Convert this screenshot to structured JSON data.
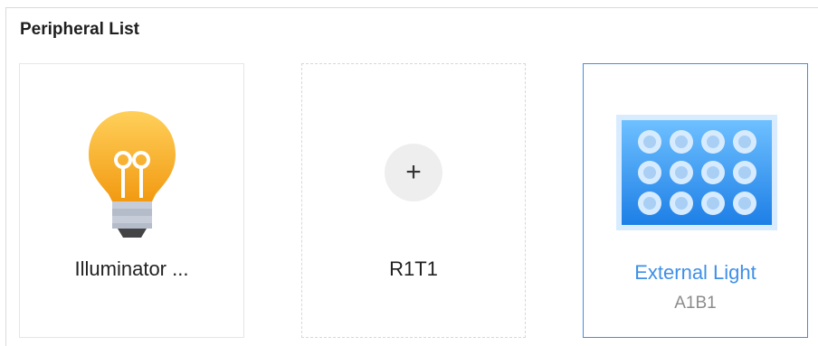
{
  "panel": {
    "title": "Peripheral List"
  },
  "cards": [
    {
      "label": "Illuminator ...",
      "icon": "light-bulb-icon"
    },
    {
      "label": "R1T1",
      "icon": "plus-icon",
      "button_symbol": "+"
    },
    {
      "label": "External Light",
      "sublabel": "A1B1",
      "icon": "led-panel-icon",
      "selected": true
    }
  ],
  "colors": {
    "accent": "#3f8fe8",
    "bulb": "#f8b21f",
    "muted_text": "#8c8c8c"
  }
}
